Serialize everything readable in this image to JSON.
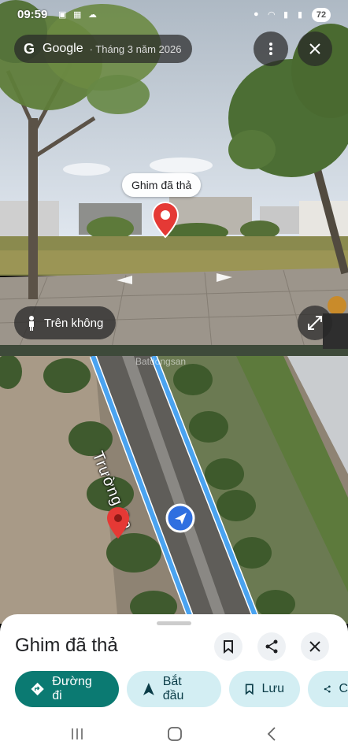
{
  "status_bar": {
    "time": "09:59",
    "battery": "72"
  },
  "street_view": {
    "brand": "Google",
    "date": "· Tháng 3 năm 2026",
    "pin_label": "Ghim đã thả",
    "aerial_label": "Trên không"
  },
  "map": {
    "road_label": "Trường Sa",
    "watermark": "Batdongsan"
  },
  "sheet": {
    "title": "Ghim đã thả",
    "actions": [
      {
        "label": "Đường đi",
        "icon": "directions-icon"
      },
      {
        "label": "Bắt đầu",
        "icon": "navigation-arrow-icon"
      },
      {
        "label": "Lưu",
        "icon": "bookmark-icon"
      },
      {
        "label": "C",
        "icon": "share-icon"
      }
    ]
  },
  "colors": {
    "primary": "#0b7a72",
    "chip": "#d3eef3",
    "route": "#4aa3f0",
    "pin": "#e53935"
  }
}
